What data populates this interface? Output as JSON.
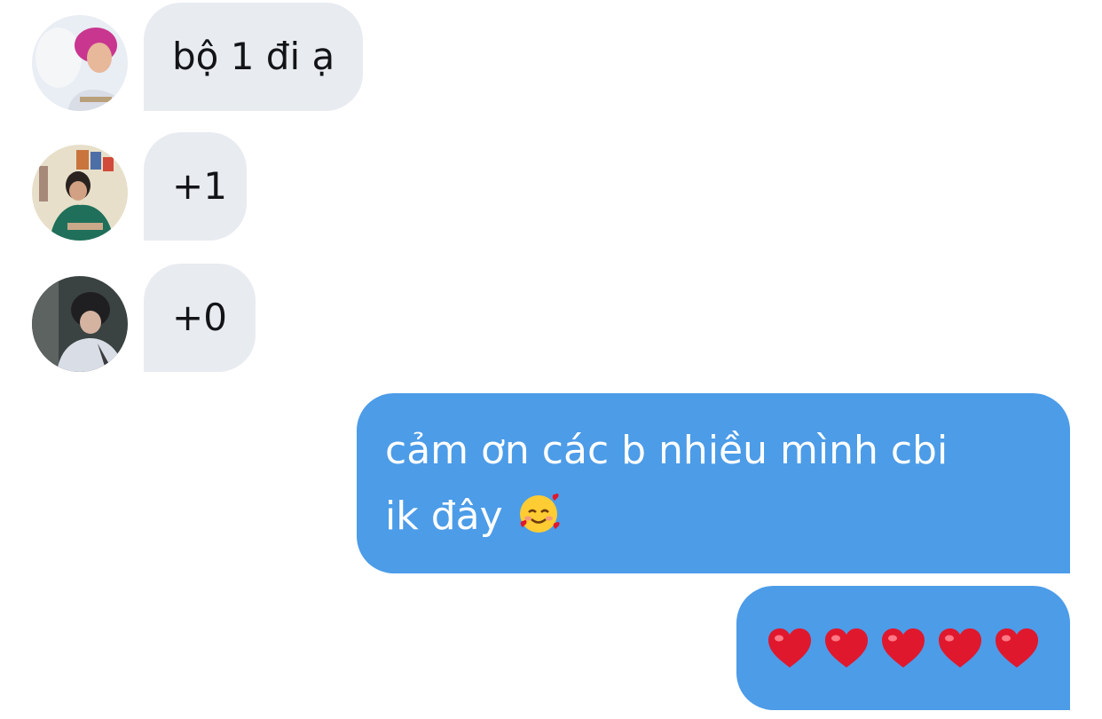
{
  "messages": {
    "incoming": [
      {
        "sender_avatar": "avatar-pink-hair",
        "text": "bộ 1 đi ạ"
      },
      {
        "sender_avatar": "avatar-room-posters",
        "text": "+1"
      },
      {
        "sender_avatar": "avatar-dark-hair",
        "text": "+0"
      }
    ],
    "outgoing": [
      {
        "text_line1": "cảm ơn các b nhiều mình cbi",
        "text_line2": "ik đây",
        "emoji": "smiling-face-with-hearts-icon"
      },
      {
        "emoji_row": [
          "heart-icon",
          "heart-icon",
          "heart-icon",
          "heart-icon",
          "heart-icon"
        ]
      }
    ]
  },
  "colors": {
    "incoming_bubble": "#e8ebf0",
    "outgoing_bubble": "#4c9ce8",
    "incoming_text": "#121417",
    "outgoing_text": "#ffffff",
    "heart": "#e0182d"
  }
}
